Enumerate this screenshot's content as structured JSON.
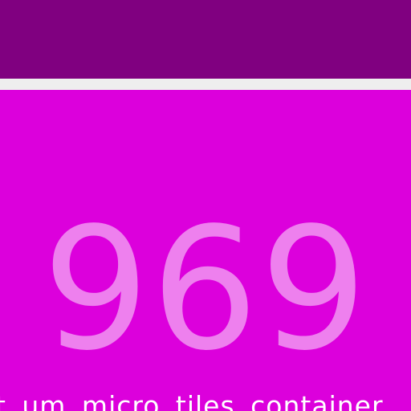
{
  "header": {
    "bar_color": "#800080"
  },
  "tile": {
    "background_color": "#dc00dc",
    "count": "969",
    "count_color": "#ee80ee",
    "caption": "tt um micro tiles container"
  }
}
